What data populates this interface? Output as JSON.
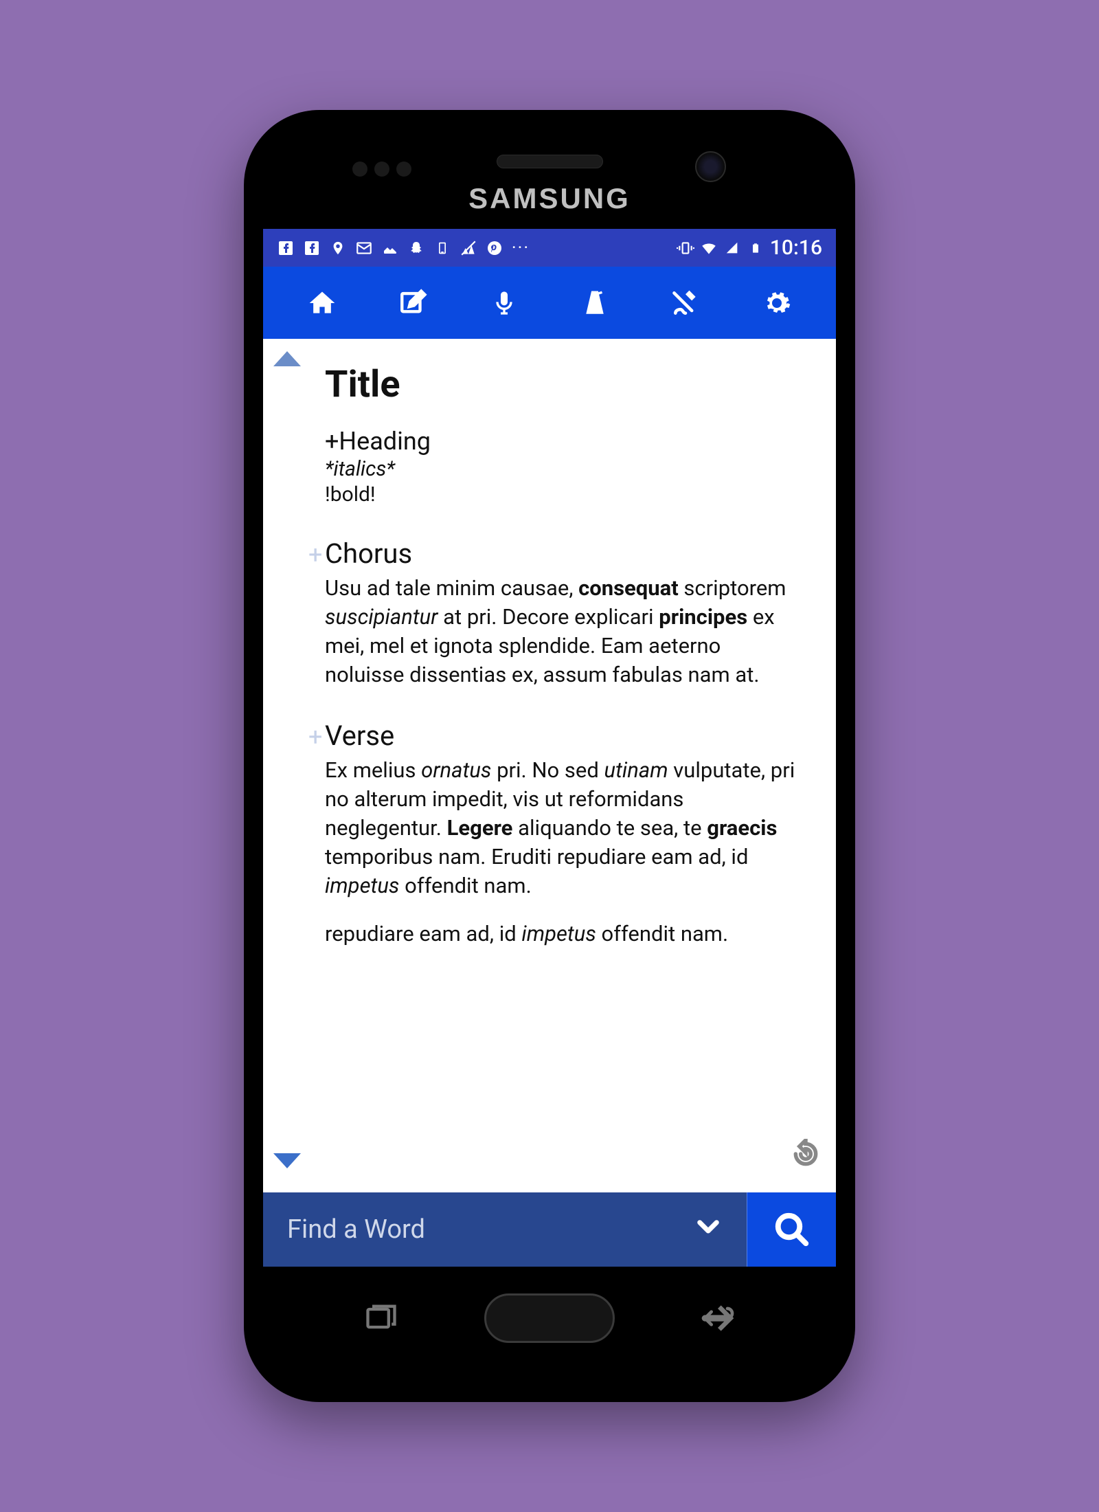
{
  "device": {
    "brand": "SAMSUNG"
  },
  "status": {
    "time": "10:16"
  },
  "editor": {
    "title": "Title",
    "heading_line": "+Heading",
    "italics_line": "*italics*",
    "bold_line": "!bold!",
    "sections": [
      {
        "heading": "Chorus",
        "body_html": "Usu ad tale minim causae, <b>consequat</b> scriptorem <i>suscipiantur</i> at pri. Decore explicari <b>principes</b> ex mei, mel et ignota splendide. Eam aeterno noluisse dissentias ex, assum fabulas nam at."
      },
      {
        "heading": "Verse",
        "body_html": "Ex melius <i>ornatus</i> pri. No sed <i>utinam</i> vulputate, pri no alterum impedit, vis ut reformidans neglegentur. <b>Legere</b> aliquando te sea, te <b>graecis</b> temporibus nam. Eruditi repudiare eam ad, id <i>impetus</i> offendit nam."
      }
    ],
    "extra_line_html": "repudiare eam ad, id <i>impetus</i> offendit nam."
  },
  "search": {
    "placeholder": "Find a Word"
  }
}
